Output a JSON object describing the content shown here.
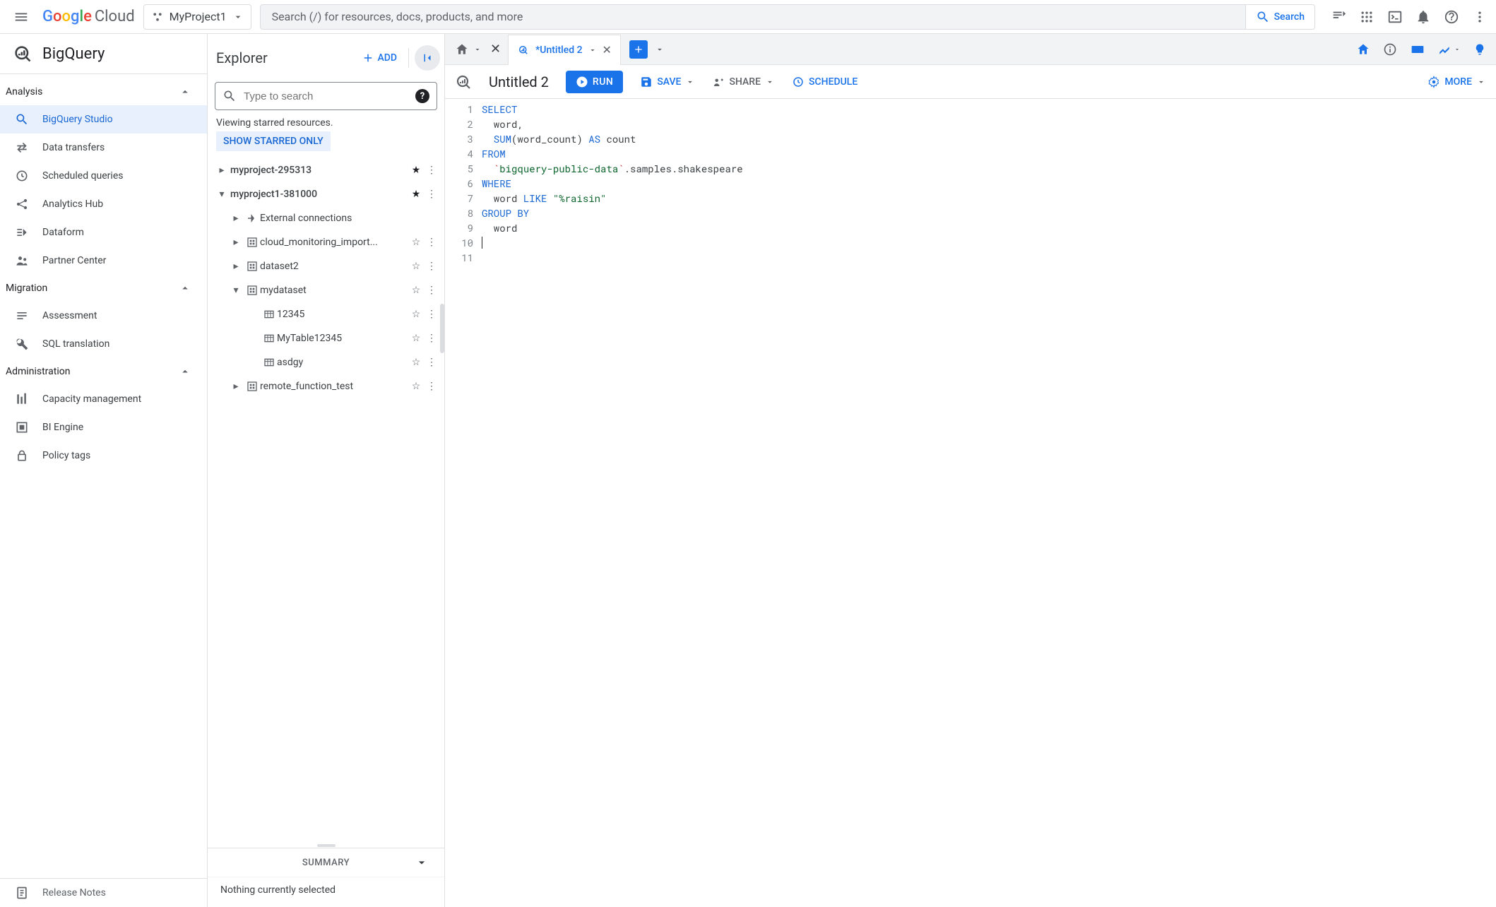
{
  "header": {
    "logo_google": "Google",
    "logo_cloud": "Cloud",
    "project_name": "MyProject1",
    "search_placeholder": "Search (/) for resources, docs, products, and more",
    "search_button": "Search"
  },
  "product": {
    "title": "BigQuery"
  },
  "left_nav": {
    "sections": {
      "analysis": "Analysis",
      "migration": "Migration",
      "administration": "Administration"
    },
    "items": {
      "bigquery_studio": "BigQuery Studio",
      "data_transfers": "Data transfers",
      "scheduled_queries": "Scheduled queries",
      "analytics_hub": "Analytics Hub",
      "dataform": "Dataform",
      "partner_center": "Partner Center",
      "assessment": "Assessment",
      "sql_translation": "SQL translation",
      "capacity_management": "Capacity management",
      "bi_engine": "BI Engine",
      "policy_tags": "Policy tags",
      "release_notes": "Release Notes"
    }
  },
  "explorer": {
    "title": "Explorer",
    "add_label": "ADD",
    "search_placeholder": "Type to search",
    "starred_text": "Viewing starred resources.",
    "show_starred": "SHOW STARRED ONLY",
    "tree": {
      "project1": "myproject-295313",
      "project2": "myproject1-381000",
      "ext_conn": "External connections",
      "cloud_mon": "cloud_monitoring_import...",
      "dataset2": "dataset2",
      "mydataset": "mydataset",
      "t_12345": "12345",
      "t_mytable": "MyTable12345",
      "t_asdgy": "asdgy",
      "remote_fn": "remote_function_test"
    },
    "summary_label": "SUMMARY",
    "summary_body": "Nothing currently selected"
  },
  "editor": {
    "tab_label": "*Untitled 2",
    "query_title": "Untitled 2",
    "run_label": "RUN",
    "save_label": "SAVE",
    "share_label": "SHARE",
    "schedule_label": "SCHEDULE",
    "more_label": "MORE",
    "code": {
      "l1_select": "SELECT",
      "l2": "  word,",
      "l3_sum": "  SUM",
      "l3_open": "(",
      "l3_wc": "word_count",
      "l3_close": ")",
      "l3_as": " AS ",
      "l3_count": "count",
      "l4_from": "FROM",
      "l5_pre": "  ",
      "l5_tick1": "`",
      "l5_ds": "bigquery-public-data",
      "l5_tick2": "`",
      "l5_rest": ".samples.shakespeare",
      "l6_where": "WHERE",
      "l7_pre": "  word ",
      "l7_like": "LIKE",
      "l7_str": " \"%raisin\"",
      "l8_group": "GROUP BY",
      "l9": "  word"
    },
    "line_numbers": [
      "1",
      "2",
      "3",
      "4",
      "5",
      "6",
      "7",
      "8",
      "9",
      "10",
      "11"
    ]
  }
}
